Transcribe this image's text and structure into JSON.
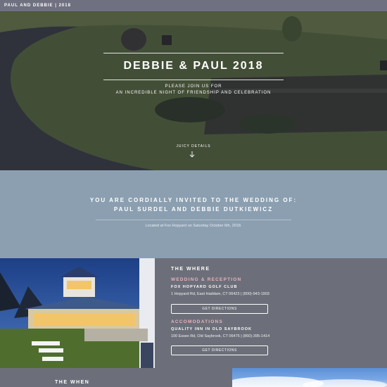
{
  "topbar": {
    "brand": "PAUL AND DEBBIE | 2018"
  },
  "hero": {
    "title": "DEBBIE & PAUL 2018",
    "subtitle_line1": "PLEASE JOIN US FOR",
    "subtitle_line2": "AN INCREDIBLE NIGHT OF FRIENDSHIP AND CELEBRATION",
    "details_link": "JUICY DETAILS"
  },
  "invite": {
    "heading_line1": "YOU ARE CORDIALLY INVITED TO THE WEDDING OF:",
    "heading_line2": "PAUL SURDEL AND DEBBIE DUTKIEWICZ",
    "location": "Located at Fox Hopyard on Saturday October 6th, 2018."
  },
  "where": {
    "title": "THE WHERE",
    "reception_label": "WEDDING & RECEPTION",
    "reception_venue": "FOX HOPYARD GOLF CLUB",
    "reception_address": "1 Hopyard Rd, East Haddam, CT 06423 | (800)-943-1903",
    "reception_button": "GET DIRECTIONS",
    "accom_label": "ACCOMODATIONS",
    "accom_venue": "QUALITY INN IN OLD SAYBROOK",
    "accom_address": "100 Essex Rd, Old Saybrook, CT 06475 | (860)-395-1414",
    "accom_button": "GET DIRECTIONS"
  },
  "when": {
    "title": "THE WHEN"
  },
  "colors": {
    "topbar": "#6f7080",
    "invite_band": "#8b9fb1",
    "section_bg": "#6c6f79",
    "accent_pink": "#e8b4bd"
  },
  "icons": {
    "details_arrow": "arrow-down-icon"
  }
}
